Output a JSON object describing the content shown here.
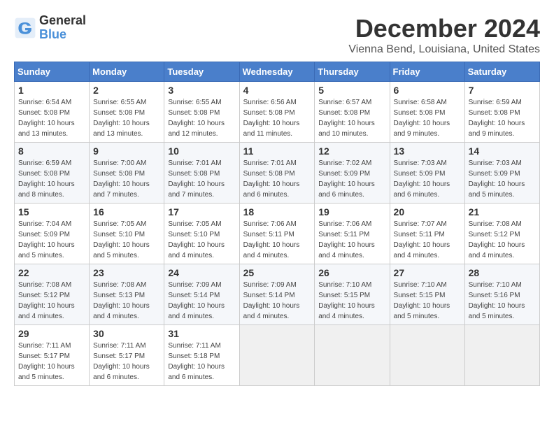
{
  "logo": {
    "general": "General",
    "blue": "Blue"
  },
  "header": {
    "month": "December 2024",
    "location": "Vienna Bend, Louisiana, United States"
  },
  "weekdays": [
    "Sunday",
    "Monday",
    "Tuesday",
    "Wednesday",
    "Thursday",
    "Friday",
    "Saturday"
  ],
  "weeks": [
    [
      {
        "day": "1",
        "sunrise": "6:54 AM",
        "sunset": "5:08 PM",
        "daylight": "10 hours and 13 minutes."
      },
      {
        "day": "2",
        "sunrise": "6:55 AM",
        "sunset": "5:08 PM",
        "daylight": "10 hours and 13 minutes."
      },
      {
        "day": "3",
        "sunrise": "6:55 AM",
        "sunset": "5:08 PM",
        "daylight": "10 hours and 12 minutes."
      },
      {
        "day": "4",
        "sunrise": "6:56 AM",
        "sunset": "5:08 PM",
        "daylight": "10 hours and 11 minutes."
      },
      {
        "day": "5",
        "sunrise": "6:57 AM",
        "sunset": "5:08 PM",
        "daylight": "10 hours and 10 minutes."
      },
      {
        "day": "6",
        "sunrise": "6:58 AM",
        "sunset": "5:08 PM",
        "daylight": "10 hours and 9 minutes."
      },
      {
        "day": "7",
        "sunrise": "6:59 AM",
        "sunset": "5:08 PM",
        "daylight": "10 hours and 9 minutes."
      }
    ],
    [
      {
        "day": "8",
        "sunrise": "6:59 AM",
        "sunset": "5:08 PM",
        "daylight": "10 hours and 8 minutes."
      },
      {
        "day": "9",
        "sunrise": "7:00 AM",
        "sunset": "5:08 PM",
        "daylight": "10 hours and 7 minutes."
      },
      {
        "day": "10",
        "sunrise": "7:01 AM",
        "sunset": "5:08 PM",
        "daylight": "10 hours and 7 minutes."
      },
      {
        "day": "11",
        "sunrise": "7:01 AM",
        "sunset": "5:08 PM",
        "daylight": "10 hours and 6 minutes."
      },
      {
        "day": "12",
        "sunrise": "7:02 AM",
        "sunset": "5:09 PM",
        "daylight": "10 hours and 6 minutes."
      },
      {
        "day": "13",
        "sunrise": "7:03 AM",
        "sunset": "5:09 PM",
        "daylight": "10 hours and 6 minutes."
      },
      {
        "day": "14",
        "sunrise": "7:03 AM",
        "sunset": "5:09 PM",
        "daylight": "10 hours and 5 minutes."
      }
    ],
    [
      {
        "day": "15",
        "sunrise": "7:04 AM",
        "sunset": "5:09 PM",
        "daylight": "10 hours and 5 minutes."
      },
      {
        "day": "16",
        "sunrise": "7:05 AM",
        "sunset": "5:10 PM",
        "daylight": "10 hours and 5 minutes."
      },
      {
        "day": "17",
        "sunrise": "7:05 AM",
        "sunset": "5:10 PM",
        "daylight": "10 hours and 4 minutes."
      },
      {
        "day": "18",
        "sunrise": "7:06 AM",
        "sunset": "5:11 PM",
        "daylight": "10 hours and 4 minutes."
      },
      {
        "day": "19",
        "sunrise": "7:06 AM",
        "sunset": "5:11 PM",
        "daylight": "10 hours and 4 minutes."
      },
      {
        "day": "20",
        "sunrise": "7:07 AM",
        "sunset": "5:11 PM",
        "daylight": "10 hours and 4 minutes."
      },
      {
        "day": "21",
        "sunrise": "7:08 AM",
        "sunset": "5:12 PM",
        "daylight": "10 hours and 4 minutes."
      }
    ],
    [
      {
        "day": "22",
        "sunrise": "7:08 AM",
        "sunset": "5:12 PM",
        "daylight": "10 hours and 4 minutes."
      },
      {
        "day": "23",
        "sunrise": "7:08 AM",
        "sunset": "5:13 PM",
        "daylight": "10 hours and 4 minutes."
      },
      {
        "day": "24",
        "sunrise": "7:09 AM",
        "sunset": "5:14 PM",
        "daylight": "10 hours and 4 minutes."
      },
      {
        "day": "25",
        "sunrise": "7:09 AM",
        "sunset": "5:14 PM",
        "daylight": "10 hours and 4 minutes."
      },
      {
        "day": "26",
        "sunrise": "7:10 AM",
        "sunset": "5:15 PM",
        "daylight": "10 hours and 4 minutes."
      },
      {
        "day": "27",
        "sunrise": "7:10 AM",
        "sunset": "5:15 PM",
        "daylight": "10 hours and 5 minutes."
      },
      {
        "day": "28",
        "sunrise": "7:10 AM",
        "sunset": "5:16 PM",
        "daylight": "10 hours and 5 minutes."
      }
    ],
    [
      {
        "day": "29",
        "sunrise": "7:11 AM",
        "sunset": "5:17 PM",
        "daylight": "10 hours and 5 minutes."
      },
      {
        "day": "30",
        "sunrise": "7:11 AM",
        "sunset": "5:17 PM",
        "daylight": "10 hours and 6 minutes."
      },
      {
        "day": "31",
        "sunrise": "7:11 AM",
        "sunset": "5:18 PM",
        "daylight": "10 hours and 6 minutes."
      },
      null,
      null,
      null,
      null
    ]
  ]
}
